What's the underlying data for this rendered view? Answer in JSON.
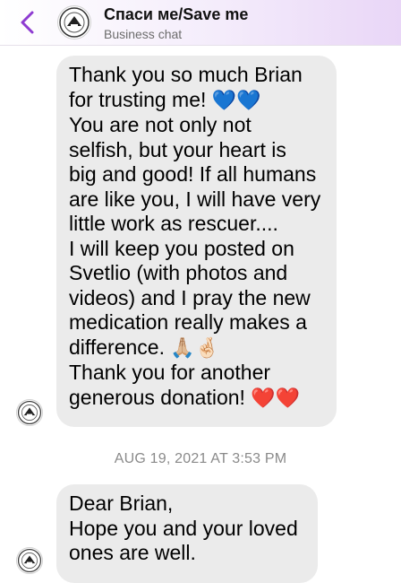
{
  "header": {
    "title": "Спаси ме/Save me",
    "subtitle": "Business chat",
    "back_icon": "chevron-left-icon",
    "accent": "#8e3bd1"
  },
  "messages": [
    {
      "sender": "business",
      "lines": [
        "Thank you so much Brian",
        "for trusting me!",
        "You are not only not",
        "selfish, but your heart is",
        "big and good! If all humans",
        "are like you, I will have very",
        "little work as rescuer....",
        "I will keep you posted on",
        "Svetlio (with photos and",
        "videos) and I pray the new",
        "medication really makes a",
        "difference.",
        "Thank you for another",
        "generous donation!"
      ],
      "emojis": {
        "line2": "💙💙",
        "line12": "🙏🏼🤞🏻",
        "line14": "❤️❤️"
      }
    },
    {
      "sender": "business",
      "lines": [
        "Dear Brian,",
        "Hope you and your loved",
        "ones are well."
      ]
    }
  ],
  "timestamp": "AUG 19, 2021 AT 3:53 PM",
  "colors": {
    "bubble": "#ebebeb",
    "timestamp": "#8a8a8a",
    "header_gradient_end": "#e9d6f7"
  }
}
